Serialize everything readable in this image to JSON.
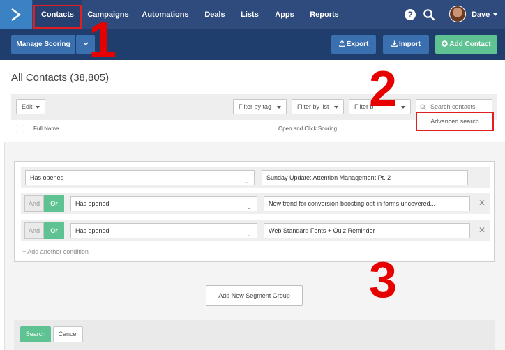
{
  "nav": {
    "items": [
      {
        "label": "Contacts",
        "active": true
      },
      {
        "label": "Campaigns"
      },
      {
        "label": "Automations"
      },
      {
        "label": "Deals"
      },
      {
        "label": "Lists"
      },
      {
        "label": "Apps"
      },
      {
        "label": "Reports"
      }
    ],
    "user": "Dave",
    "icons": [
      "logo-chevron-icon",
      "help-icon",
      "search-icon",
      "avatar"
    ]
  },
  "subbar": {
    "manage_scoring": "Manage Scoring",
    "export": "Export",
    "import": "Import",
    "add_contact": "Add Contact"
  },
  "page": {
    "title": "All Contacts (38,805)"
  },
  "toolbar": {
    "edit": "Edit",
    "filter_tag": "Filter by tag",
    "filter_list": "Filter by list",
    "filter_more": "Filter b",
    "search_placeholder": "Search contacts",
    "advanced_search": "Advanced search"
  },
  "table_header": {
    "full_name": "Full Name",
    "scoring": "Open and Click Scoring"
  },
  "segment": {
    "conditions": [
      {
        "connector": null,
        "field": "Has opened",
        "value": "Sunday Update: Attention Management Pt. 2"
      },
      {
        "connector": {
          "and": "And",
          "or": "Or",
          "selected": "Or"
        },
        "field": "Has opened",
        "value": "New trend for conversion-boosting opt-in forms uncovered..."
      },
      {
        "connector": {
          "and": "And",
          "or": "Or",
          "selected": "Or"
        },
        "field": "Has opened",
        "value": "Web Standard Fonts + Quiz Reminder"
      }
    ],
    "add_condition": "+ Add another condition",
    "add_group": "Add New Segment Group",
    "search": "Search",
    "cancel": "Cancel",
    "remove_symbol": "✕"
  },
  "annotations": [
    "1",
    "2",
    "3"
  ],
  "colors": {
    "nav_bg": "#2f4a7c",
    "subbar_bg": "#1f3d6d",
    "logo_bg": "#3b82c4",
    "accent_green": "#5fc293",
    "annotation_red": "#e60000"
  }
}
